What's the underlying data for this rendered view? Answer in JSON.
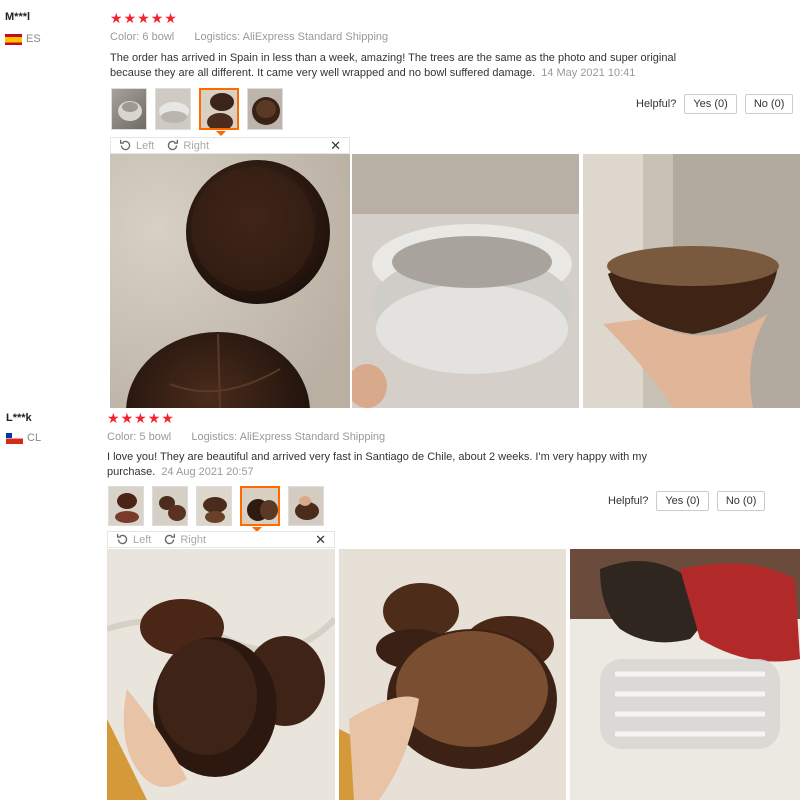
{
  "reviews": [
    {
      "user": "M***l",
      "country": "ES",
      "rating": 5,
      "color_label": "Color:",
      "color_value": "6 bowl",
      "logistics_label": "Logistics:",
      "logistics_value": "AliExpress Standard Shipping",
      "text": "The order has arrived in Spain in less than a week, amazing! The trees are the same as the photo and super original because they are all different. It came very well wrapped and no bowl suffered damage.",
      "date": "14 May 2021 10:41",
      "helpful_label": "Helpful?",
      "yes_label": "Yes (0)",
      "no_label": "No (0)",
      "viewer": {
        "left_label": "Left",
        "right_label": "Right",
        "close_icon": "close-icon"
      }
    },
    {
      "user": "L***k",
      "country": "CL",
      "rating": 5,
      "color_label": "Color:",
      "color_value": "5 bowl",
      "logistics_label": "Logistics:",
      "logistics_value": "AliExpress Standard Shipping",
      "text": "I love you! They are beautiful and arrived very fast in Santiago de Chile, about 2 weeks. I'm very happy with my purchase.",
      "date": "24 Aug 2021 20:57",
      "helpful_label": "Helpful?",
      "yes_label": "Yes (0)",
      "no_label": "No (0)",
      "viewer": {
        "left_label": "Left",
        "right_label": "Right",
        "close_icon": "close-icon"
      }
    }
  ],
  "colors": {
    "star": "#f5222d",
    "accent": "#ff6a00",
    "meta": "#999999"
  }
}
